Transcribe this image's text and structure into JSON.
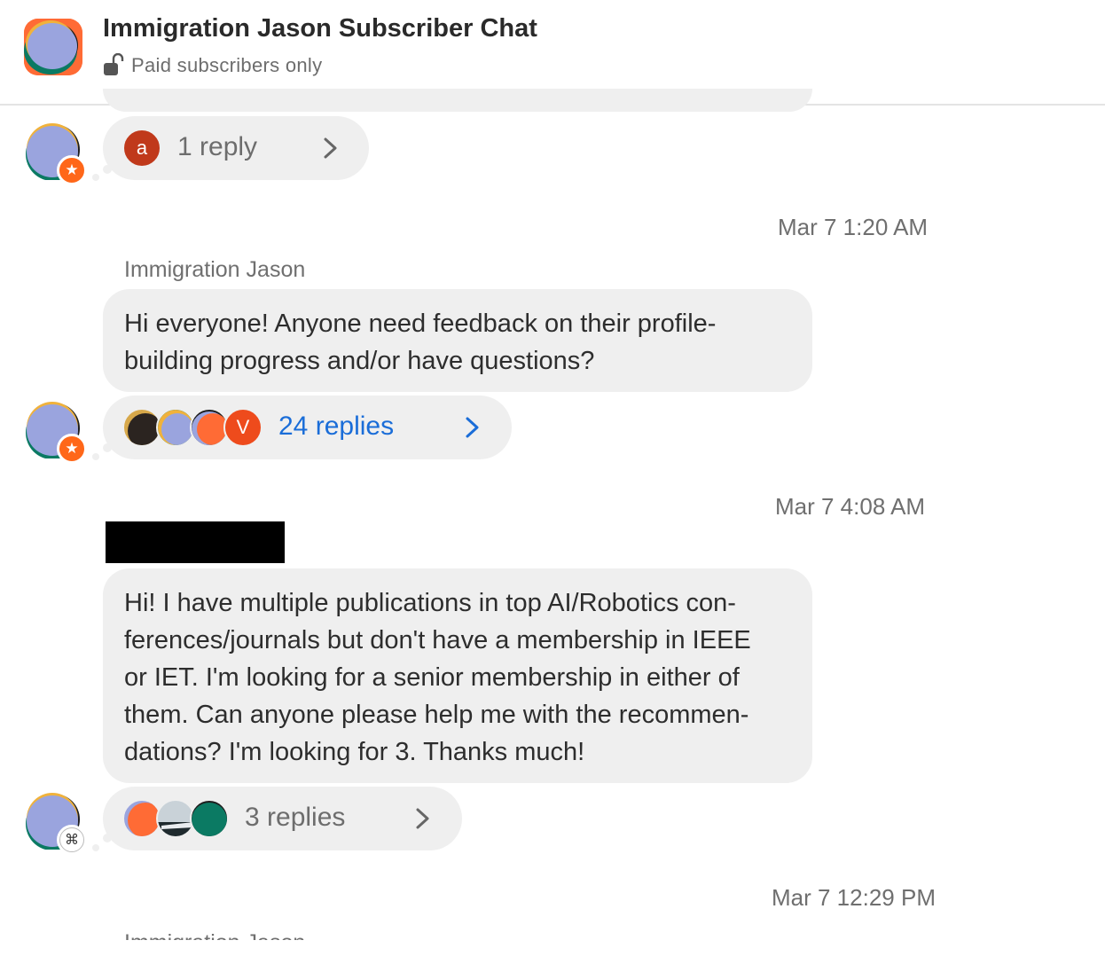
{
  "header": {
    "title": "Immigration Jason Subscriber Chat",
    "subtitle": "Paid subscribers only",
    "lock_icon": "unlocked-padlock-icon"
  },
  "messages": [
    {
      "replies": {
        "count_label": "1 reply",
        "avatar_letter": "a",
        "label_color": "#6d6d6d"
      }
    },
    {
      "timestamp": "Mar 7 1:20 AM",
      "sender": "Immigration Jason",
      "text": "Hi everyone! Anyone need feedback on their profile-building progress and/or have questions?",
      "lines": [
        "Hi everyone! Anyone need feedback on their profile-",
        "building progress and/or have questions?"
      ],
      "replies": {
        "count_label": "24 replies",
        "avatar_letter": "V",
        "label_color": "#1a6dd8"
      }
    },
    {
      "timestamp": "Mar 7 4:08 AM",
      "sender": "",
      "lines": [
        "Hi! I have multiple publications in top AI/Robotics con-",
        "ferences/journals but don't have a membership in IEEE",
        "or IET. I'm looking for a senior membership in either of",
        "them. Can anyone please help me with the recommen-",
        "dations? I'm looking for 3. Thanks much!"
      ],
      "replies": {
        "count_label": "3 replies",
        "label_color": "#6d6d6d"
      }
    },
    {
      "timestamp": "Mar 7 12:29 PM",
      "sender": "Immigration Jason"
    }
  ],
  "colors": {
    "accent": "#ff6719",
    "bubble": "#efefef",
    "link": "#1a6dd8"
  }
}
